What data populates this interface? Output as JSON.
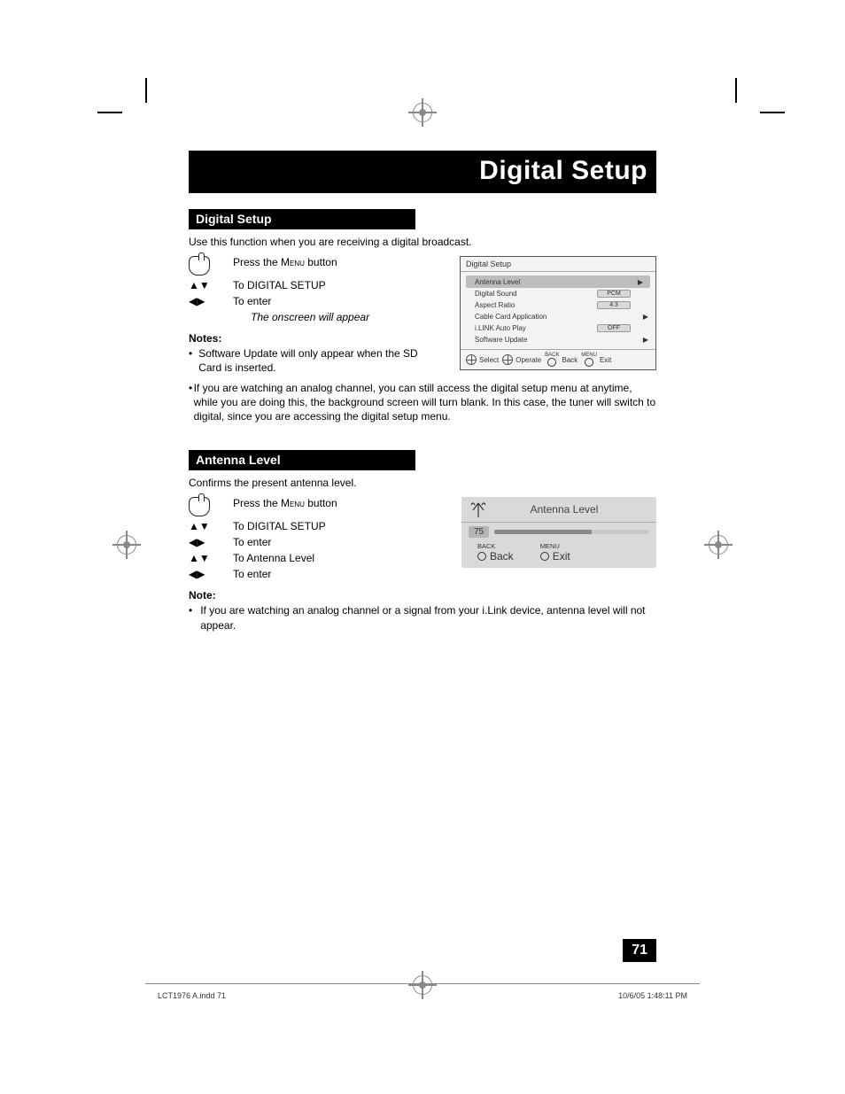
{
  "page_title": "Digital Setup",
  "section1": {
    "heading": "Digital Setup",
    "intro": "Use this function when you are receiving a digital broadcast.",
    "steps": [
      {
        "icon": "hand",
        "text_prefix": "Press the ",
        "text_caps": "Menu",
        "text_suffix": " button"
      },
      {
        "icon": "updown",
        "text": "To DIGITAL SETUP"
      },
      {
        "icon": "leftright",
        "text": "To enter"
      }
    ],
    "onscreen": "The onscreen will appear",
    "notes_heading": "Notes:",
    "notes": [
      "Software Update will only appear when the SD Card is inserted.",
      "If you are watching an analog channel, you can still access the digital setup menu at anytime, while you are doing this, the background screen will turn blank.  In this case, the tuner will switch to digital, since you are accessing the digital setup menu."
    ]
  },
  "osd": {
    "title": "Digital Setup",
    "rows": [
      {
        "label": "Antenna Level",
        "value": "",
        "arrow": "▶",
        "highlight": true
      },
      {
        "label": "Digital Sound",
        "value": "PCM",
        "arrow": ""
      },
      {
        "label": "Aspect Ratio",
        "value": "4:3",
        "arrow": ""
      },
      {
        "label": "Cable Card Application",
        "value": "",
        "arrow": "▶"
      },
      {
        "label": "i.LINK Auto Play",
        "value": "OFF",
        "arrow": ""
      },
      {
        "label": "Software Update",
        "value": "",
        "arrow": "▶"
      }
    ],
    "footer": {
      "select": "Select",
      "operate": "Operate",
      "back_tiny": "BACK",
      "back": "Back",
      "menu_tiny": "MENU",
      "exit": "Exit"
    }
  },
  "section2": {
    "heading": "Antenna Level",
    "intro": "Confirms the present antenna level.",
    "steps": [
      {
        "icon": "hand",
        "text_prefix": "Press the ",
        "text_caps": "Menu",
        "text_suffix": " button"
      },
      {
        "icon": "updown",
        "text": "To DIGITAL SETUP"
      },
      {
        "icon": "leftright",
        "text": "To enter"
      },
      {
        "icon": "updown",
        "text": "To Antenna Level"
      },
      {
        "icon": "leftright",
        "text": "To enter"
      }
    ],
    "note_heading": "Note:",
    "note": "If you are watching an analog channel or a signal from your i.Link device, antenna level will not appear."
  },
  "al_panel": {
    "title": "Antenna Level",
    "value": "75",
    "back_tiny": "BACK",
    "back": "Back",
    "menu_tiny": "MENU",
    "exit": "Exit"
  },
  "page_number": "71",
  "footer_left": "LCT1976 A.indd   71",
  "footer_right": "10/6/05   1:48:11 PM"
}
